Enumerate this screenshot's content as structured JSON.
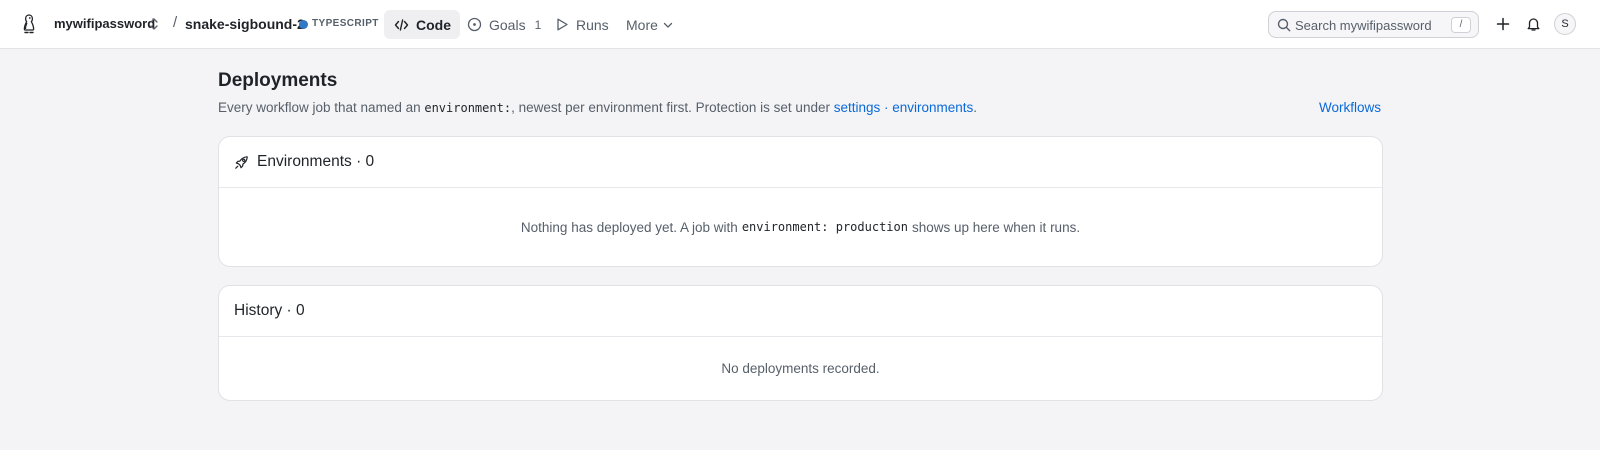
{
  "colors": {
    "accent_link": "#0969da",
    "language_dot": "#3178c6",
    "page_background": "#f4f4f6"
  },
  "topbar": {
    "logo_icon": "penguin-logo-icon",
    "org_name": "mywifipassword",
    "separator": "/",
    "repo_name": "snake-sigbound-2",
    "language": "TYPESCRIPT",
    "tabs": [
      {
        "label": "Code",
        "icon": "code-icon",
        "active": true
      },
      {
        "label": "Goals",
        "icon": "circle-dot-icon",
        "count": "1"
      },
      {
        "label": "Runs",
        "icon": "play-icon"
      },
      {
        "label": "More",
        "icon": "chevron-down-icon"
      }
    ],
    "search": {
      "placeholder": "Search mywifipassword",
      "shortcut": "/"
    },
    "avatar_initial": "S"
  },
  "page": {
    "title": "Deployments",
    "description": {
      "part1": "Every workflow job that named an ",
      "code": "environment:",
      "part2": ", newest per environment first. Protection is set under ",
      "link1": "settings",
      "sep": " · ",
      "link2": "environments",
      "end": "."
    },
    "workflows_link": "Workflows"
  },
  "environments": {
    "icon": "rocket-icon",
    "title": "Environments · 0",
    "empty": {
      "part1": "Nothing has deployed yet. A job with",
      "code": "environment: production",
      "part2": "shows up here when it runs."
    }
  },
  "history": {
    "title": "History · 0",
    "empty": "No deployments recorded."
  }
}
